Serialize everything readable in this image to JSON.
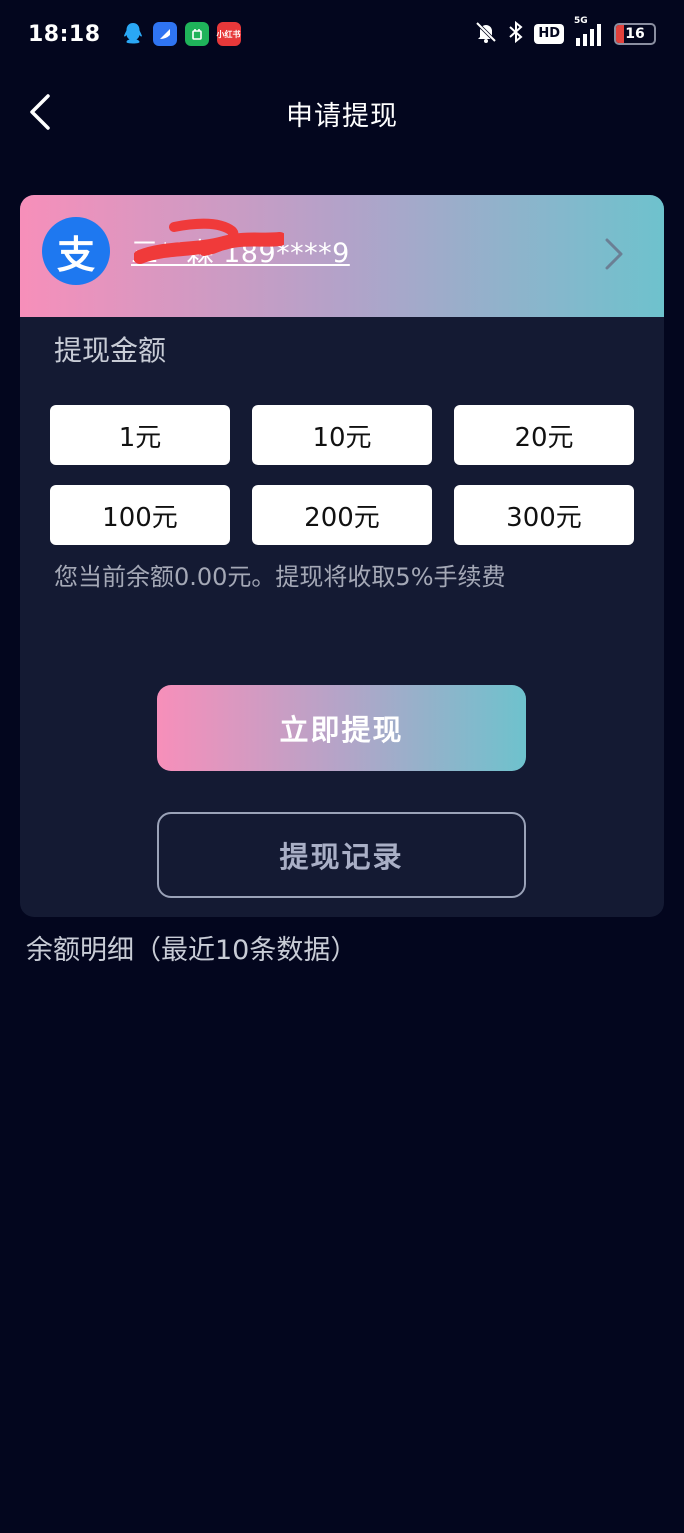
{
  "status_bar": {
    "time": "18:18",
    "network": "5G",
    "hd": "HD",
    "battery": "16",
    "apps": [
      {
        "icon": "qq-icon",
        "label": ""
      },
      {
        "icon": "blue-app-icon",
        "label": ""
      },
      {
        "icon": "green-app-icon",
        "label": ""
      },
      {
        "icon": "xiaohongshu-icon",
        "label": "小红书"
      }
    ],
    "icons": [
      "mute-bell-icon",
      "bluetooth-icon",
      "signal-icon"
    ]
  },
  "header": {
    "title": "申请提现",
    "back_icon": "chevron-left-icon"
  },
  "account": {
    "icon_glyph": "支",
    "text": "三**森 189****9",
    "chevron_icon": "chevron-right-icon"
  },
  "withdraw": {
    "section_label": "提现金额",
    "amounts": [
      "1元",
      "10元",
      "20元",
      "100元",
      "200元",
      "300元"
    ],
    "note": "您当前余额0.00元。提现将收取5%手续费",
    "submit_label": "立即提现",
    "record_label": "提现记录"
  },
  "details": {
    "label": "余额明细（最近10条数据）"
  },
  "colors": {
    "background": "#03061e",
    "card": "#141a33",
    "gradient_start": "#f78fba",
    "gradient_end": "#6ec2cd",
    "alipay_blue": "#1e78f0"
  }
}
